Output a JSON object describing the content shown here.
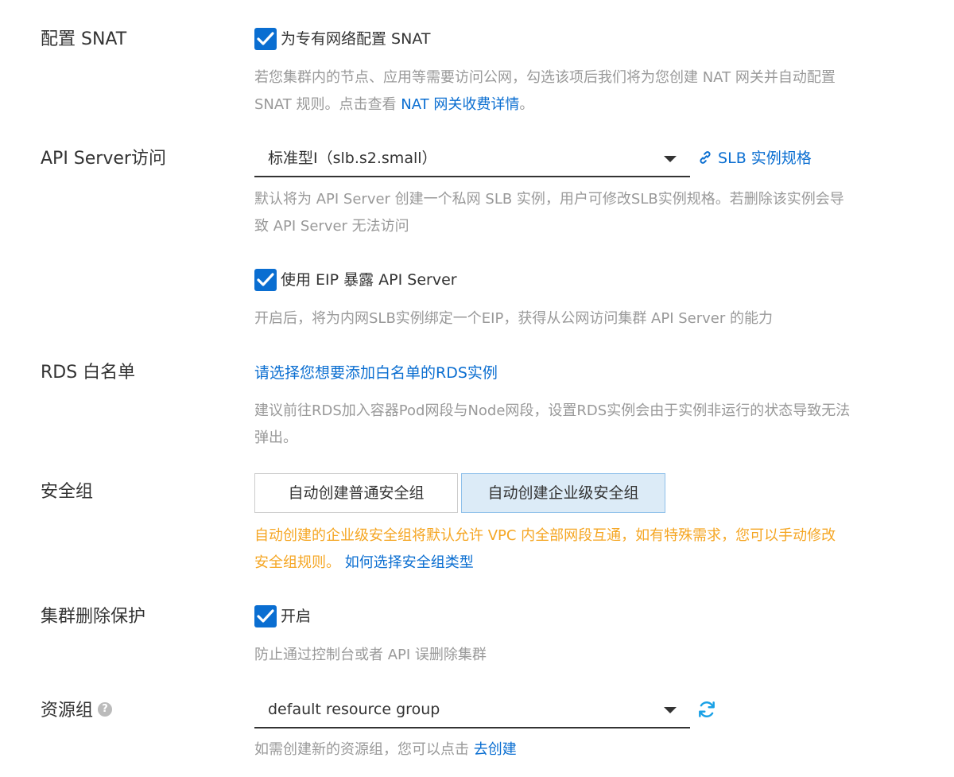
{
  "snat": {
    "label": "配置 SNAT",
    "checkbox_label": "为专有网络配置 SNAT",
    "checked": true,
    "desc_line1": "若您集群内的节点、应用等需要访问公网，勾选该项后我们将为您创建 NAT 网关并自动配置",
    "desc_line2_prefix": "SNAT 规则。点击查看 ",
    "desc_link": "NAT 网关收费详情",
    "desc_line2_suffix": "。"
  },
  "api_server": {
    "label": "API Server访问",
    "select_value": "标准型I（slb.s2.small）",
    "spec_link": "SLB 实例规格",
    "desc_line1": "默认将为 API Server 创建一个私网 SLB 实例，用户可修改SLB实例规格。若删除该实例会导",
    "desc_line2": "致 API Server 无法访问",
    "eip_checkbox_label": "使用 EIP 暴露 API Server",
    "eip_checked": true,
    "eip_desc": "开启后，将为内网SLB实例绑定一个EIP，获得从公网访问集群 API Server 的能力"
  },
  "rds": {
    "label": "RDS 白名单",
    "select_link": "请选择您想要添加白名单的RDS实例",
    "desc_line1": "建议前往RDS加入容器Pod网段与Node网段，设置RDS实例会由于实例非运行的状态导致无法",
    "desc_line2": "弹出。"
  },
  "security_group": {
    "label": "安全组",
    "options": [
      "自动创建普通安全组",
      "自动创建企业级安全组"
    ],
    "selected": "自动创建企业级安全组",
    "warn_line1": "自动创建的企业级安全组将默认允许 VPC 内全部网段互通，如有特殊需求，您可以手动修改",
    "warn_line2_prefix": "安全组规则。 ",
    "warn_link": "如何选择安全组类型"
  },
  "delete_protection": {
    "label": "集群删除保护",
    "checkbox_label": "开启",
    "checked": true,
    "desc": "防止通过控制台或者 API 误删除集群"
  },
  "resource_group": {
    "label": "资源组",
    "help_icon": "?",
    "select_value": "default resource group",
    "desc_prefix": "如需创建新的资源组，您可以点击 ",
    "desc_link": "去创建"
  },
  "colors": {
    "accent": "#0a6ed1",
    "warning": "#f5a623",
    "muted": "#999999",
    "selected_bg": "#dcebf7"
  }
}
